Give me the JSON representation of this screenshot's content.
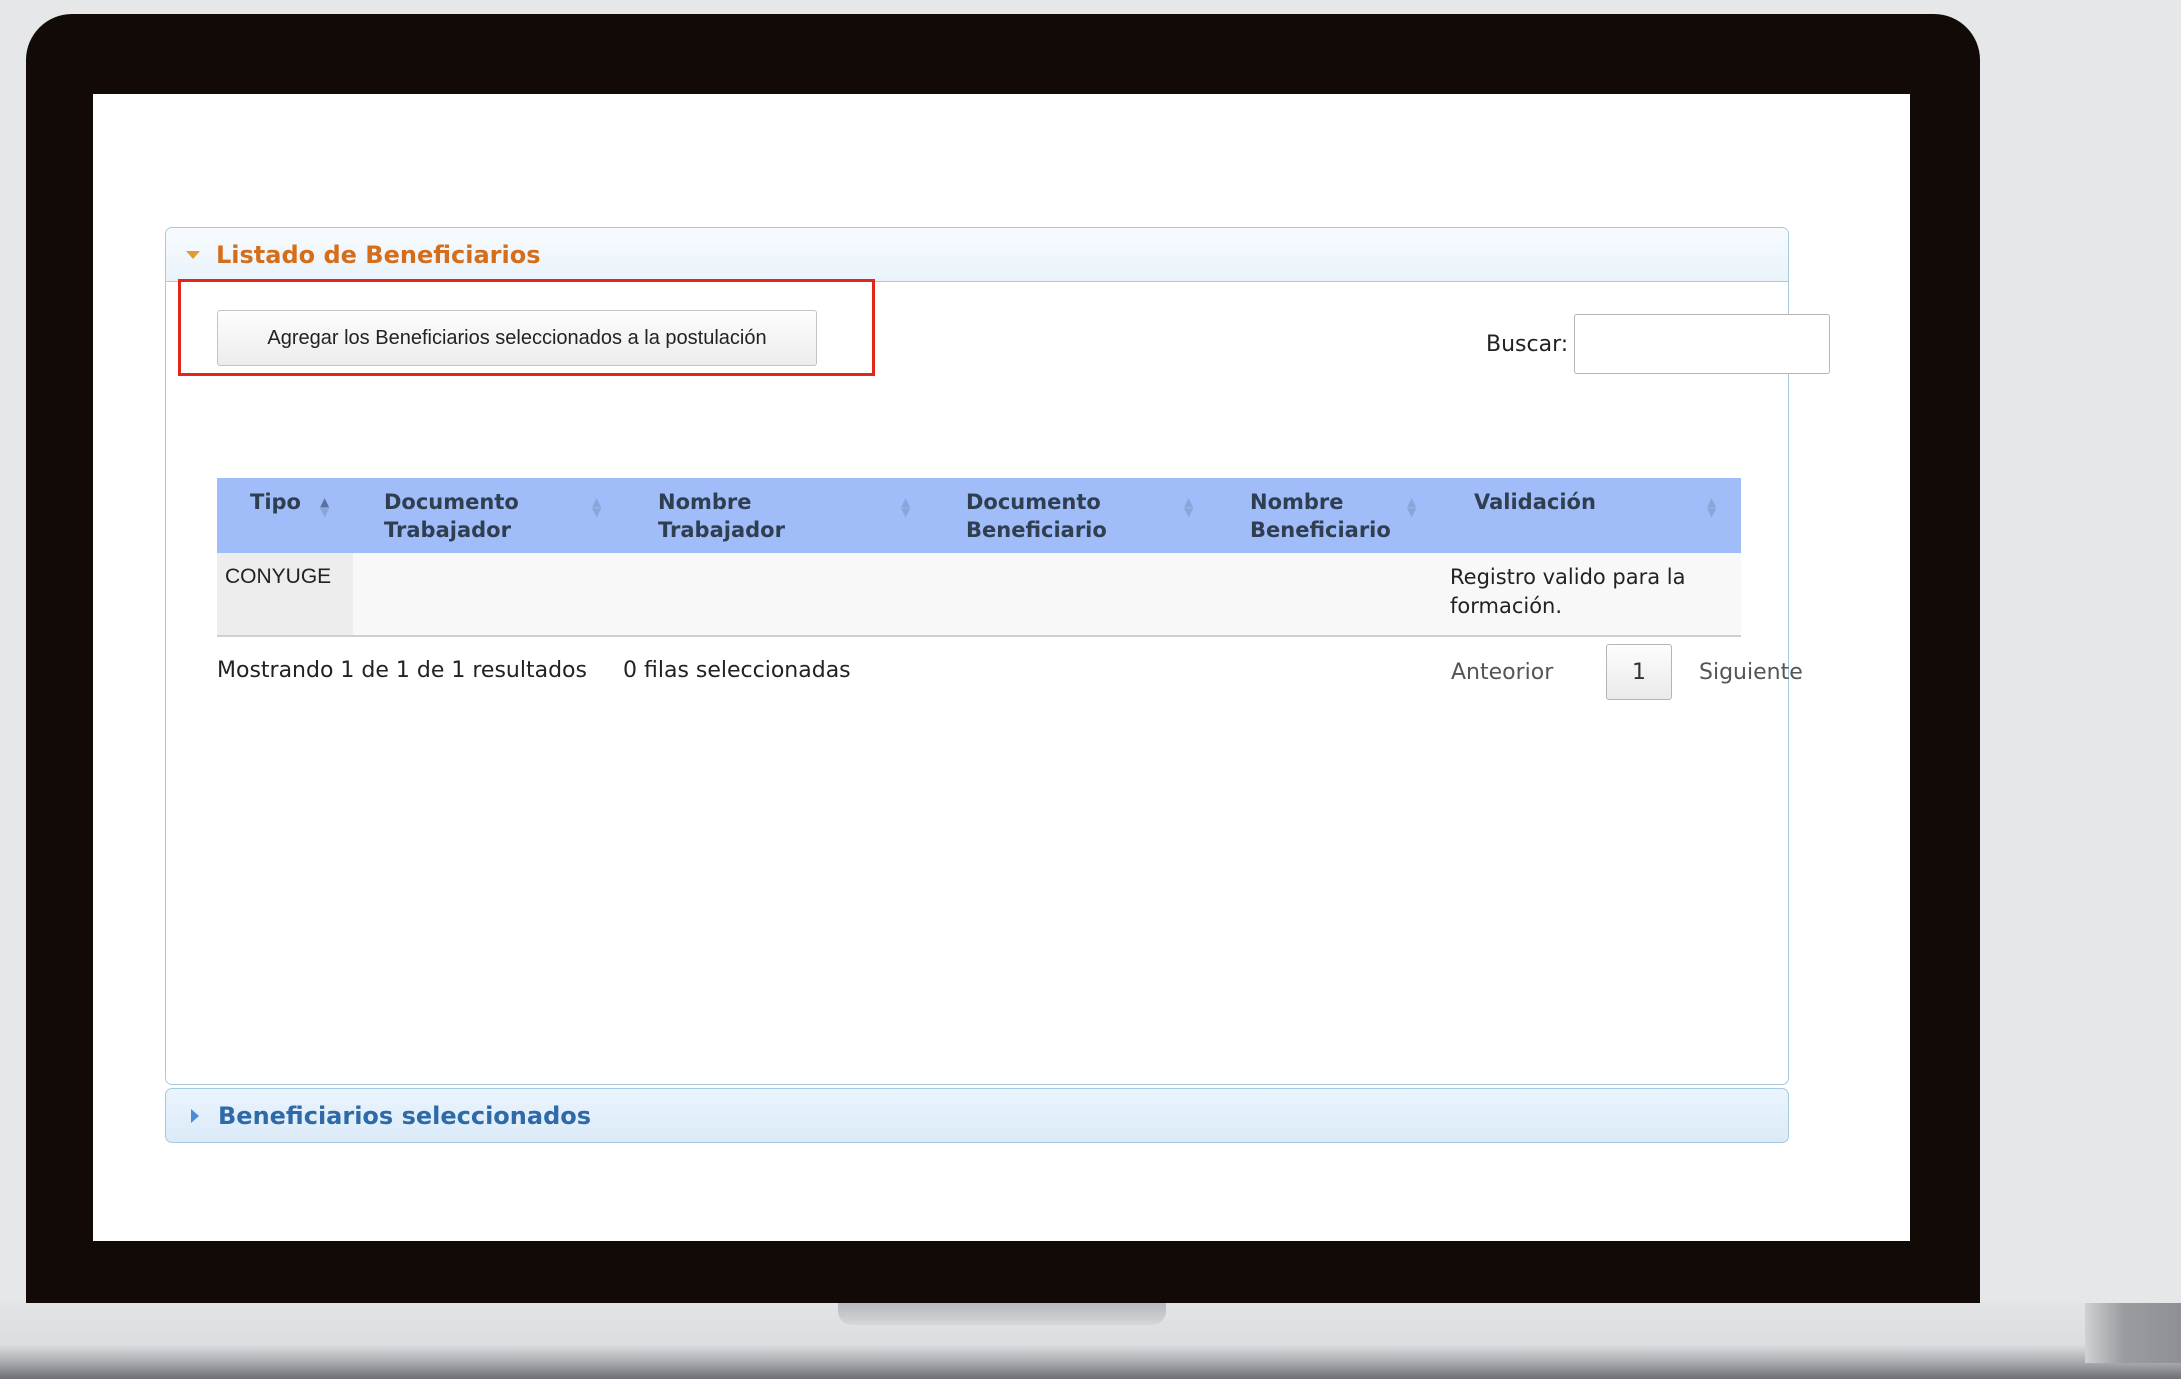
{
  "panel": {
    "title": "Listado de Beneficiarios",
    "add_button_label": "Agregar los Beneficiarios seleccionados a la postulación",
    "search_label": "Buscar:",
    "search_value": "",
    "columns": [
      {
        "label_line1": "Tipo",
        "label_line2": ""
      },
      {
        "label_line1": "Documento",
        "label_line2": "Trabajador"
      },
      {
        "label_line1": "Nombre",
        "label_line2": "Trabajador"
      },
      {
        "label_line1": "Documento",
        "label_line2": "Beneficiario"
      },
      {
        "label_line1": "Nombre",
        "label_line2": "Beneficiario"
      },
      {
        "label_line1": "Validación",
        "label_line2": ""
      }
    ],
    "rows": [
      {
        "tipo": "CONYUGE",
        "documento_trabajador": "",
        "nombre_trabajador": "",
        "documento_beneficiario": "",
        "nombre_beneficiario": "",
        "validacion": "Registro valido para la formación."
      }
    ],
    "footer": {
      "info": "Mostrando 1 de 1 de 1 resultados",
      "selected": "0 filas seleccionadas",
      "prev": "Anteorior",
      "page": "1",
      "next": "Siguiente"
    }
  },
  "panel2": {
    "title": "Beneficiarios seleccionados"
  },
  "colors": {
    "header_blue": "#a0bcf9",
    "title_orange": "#d56e1a",
    "highlight_red": "#e1261c",
    "accordion_blue": "#2e6aa8"
  },
  "icons": [
    "caret-down-icon",
    "caret-right-icon",
    "sort-asc-icon",
    "sort-both-icon"
  ]
}
